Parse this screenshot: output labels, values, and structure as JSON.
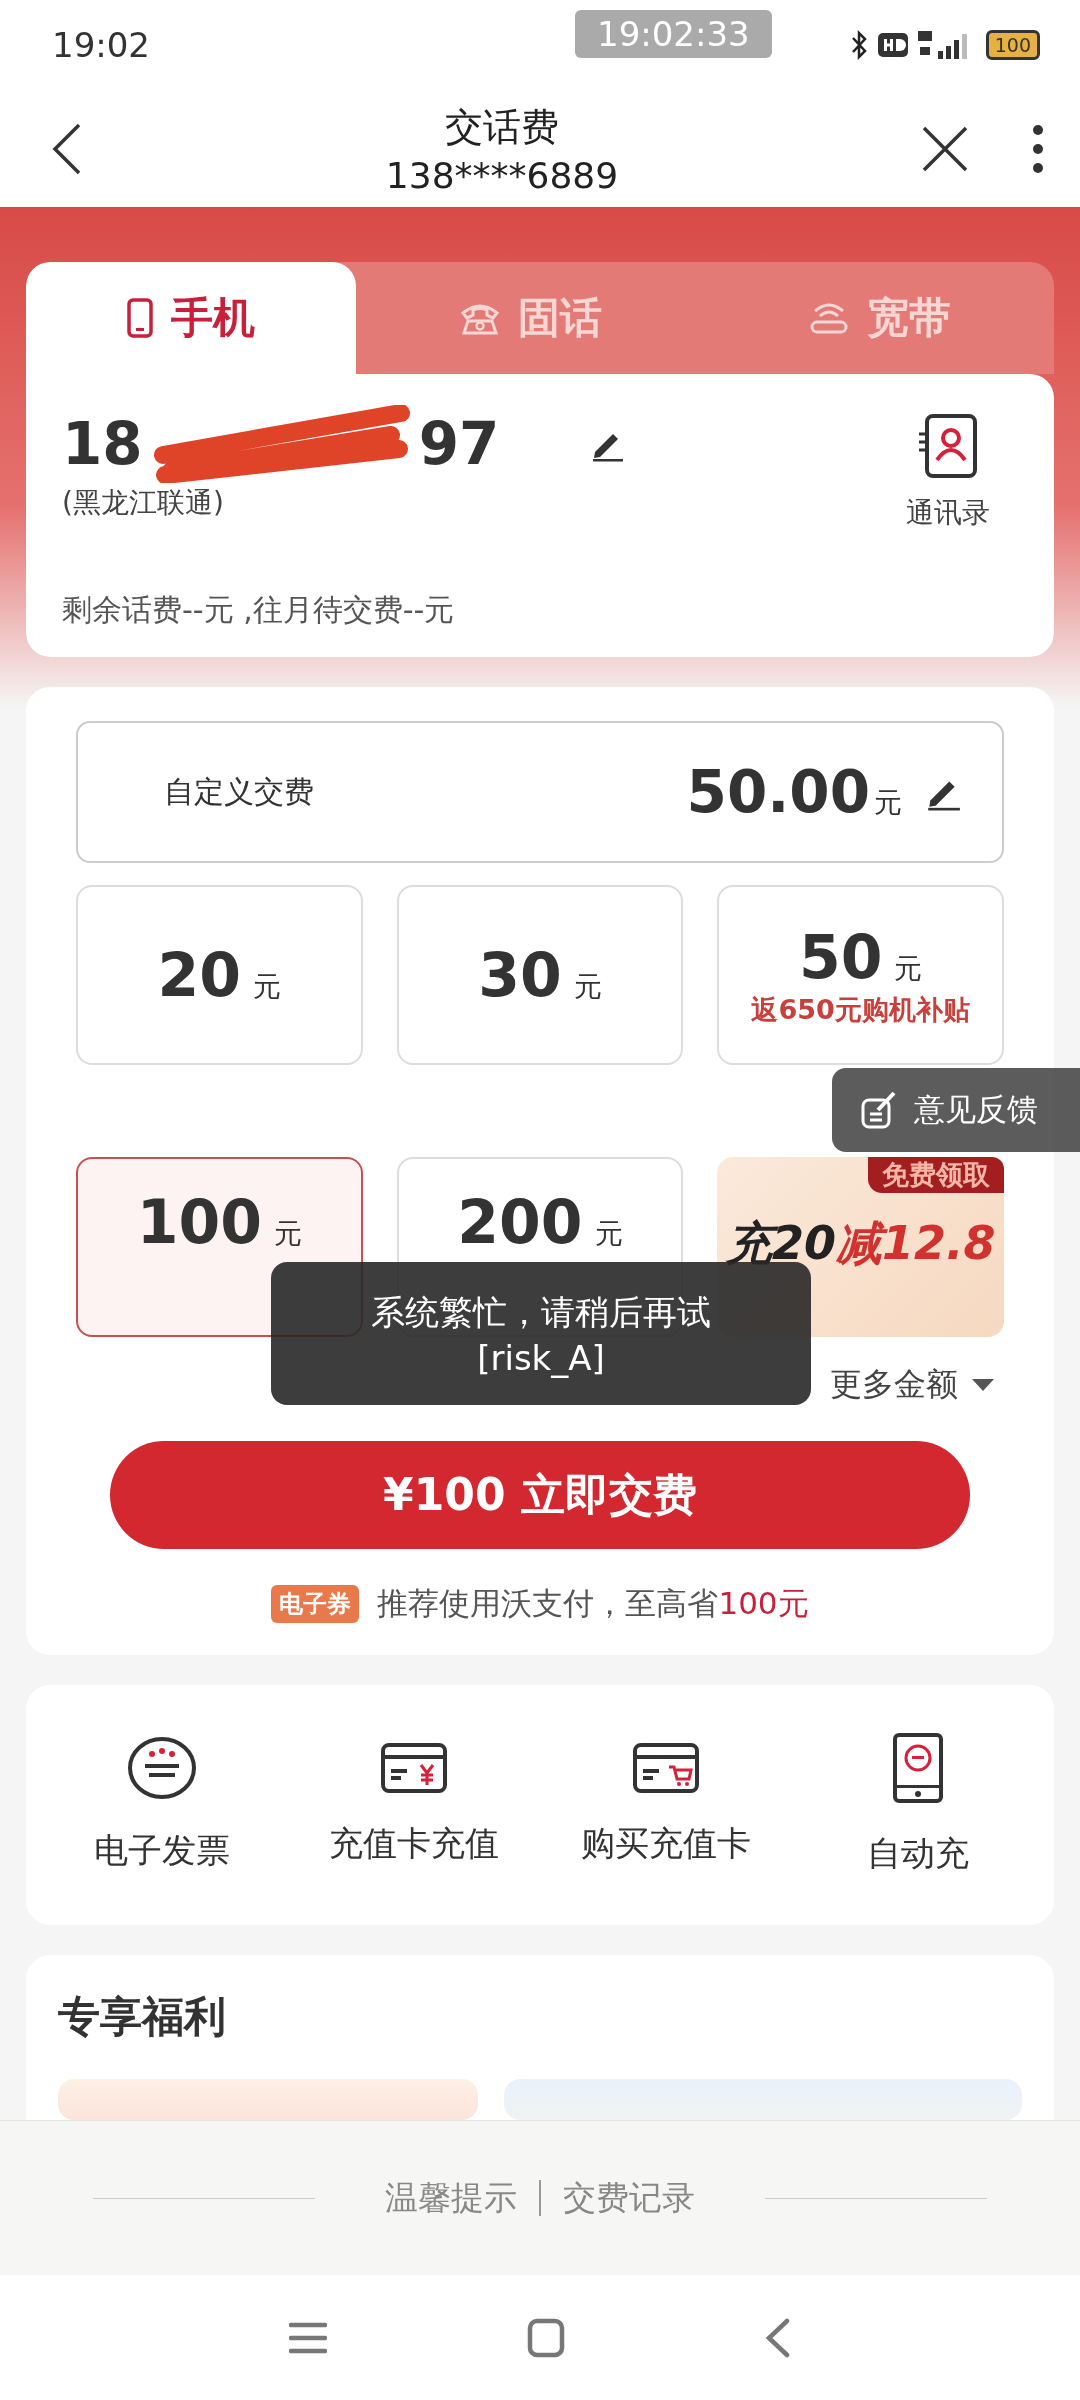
{
  "status_bar": {
    "time": "19:02",
    "screen_clock": "19:02:33",
    "battery": "100"
  },
  "header": {
    "title": "交话费",
    "subtitle": "138****6889"
  },
  "tabs": [
    {
      "label": "手机",
      "kind": "mobile",
      "selected": true
    },
    {
      "label": "固话",
      "kind": "landline",
      "selected": false
    },
    {
      "label": "宽带",
      "kind": "broadband",
      "selected": false
    }
  ],
  "account": {
    "number_start": "18",
    "number_end": "97",
    "carrier": "(黑龙江联通)",
    "contacts_label": "通讯录",
    "balance_note": "剩余话费--元 ,往月待交费--元"
  },
  "custom_fee": {
    "label": "自定义交费",
    "amount": "50.00",
    "unit": "元"
  },
  "amounts": [
    {
      "kind": "plain",
      "value": "20",
      "unit": "元",
      "selected": false
    },
    {
      "kind": "plain",
      "value": "30",
      "unit": "元",
      "selected": false
    },
    {
      "kind": "plain",
      "value": "50",
      "unit": "元",
      "subsidy": "返650元购机补贴",
      "selected": false
    },
    {
      "kind": "plain",
      "value": "100",
      "unit": "元",
      "selected": true
    },
    {
      "kind": "plain",
      "value": "200",
      "unit": "元",
      "selected": false
    },
    {
      "kind": "promo",
      "badge": "免费领取",
      "main": "充20",
      "highlight": "减12.8",
      "selected": false
    }
  ],
  "more_amounts": "更多金额",
  "pay_button": "¥100 立即交费",
  "coupon": {
    "tag": "电子券",
    "text": "推荐使用沃支付，至高省",
    "highlight": "100元"
  },
  "quick_actions": [
    {
      "label": "电子发票",
      "kind": "invoice"
    },
    {
      "label": "充值卡充值",
      "kind": "card-yuan"
    },
    {
      "label": "购买充值卡",
      "kind": "card-cart"
    },
    {
      "label": "自动充",
      "kind": "auto"
    }
  ],
  "benefits": {
    "title": "专享福利"
  },
  "footer_links": [
    "温馨提示",
    "交费记录"
  ],
  "feedback_button": "意见反馈",
  "toast": {
    "message": "系统繁忙，请稍后再试",
    "code": "[risk_A]"
  }
}
